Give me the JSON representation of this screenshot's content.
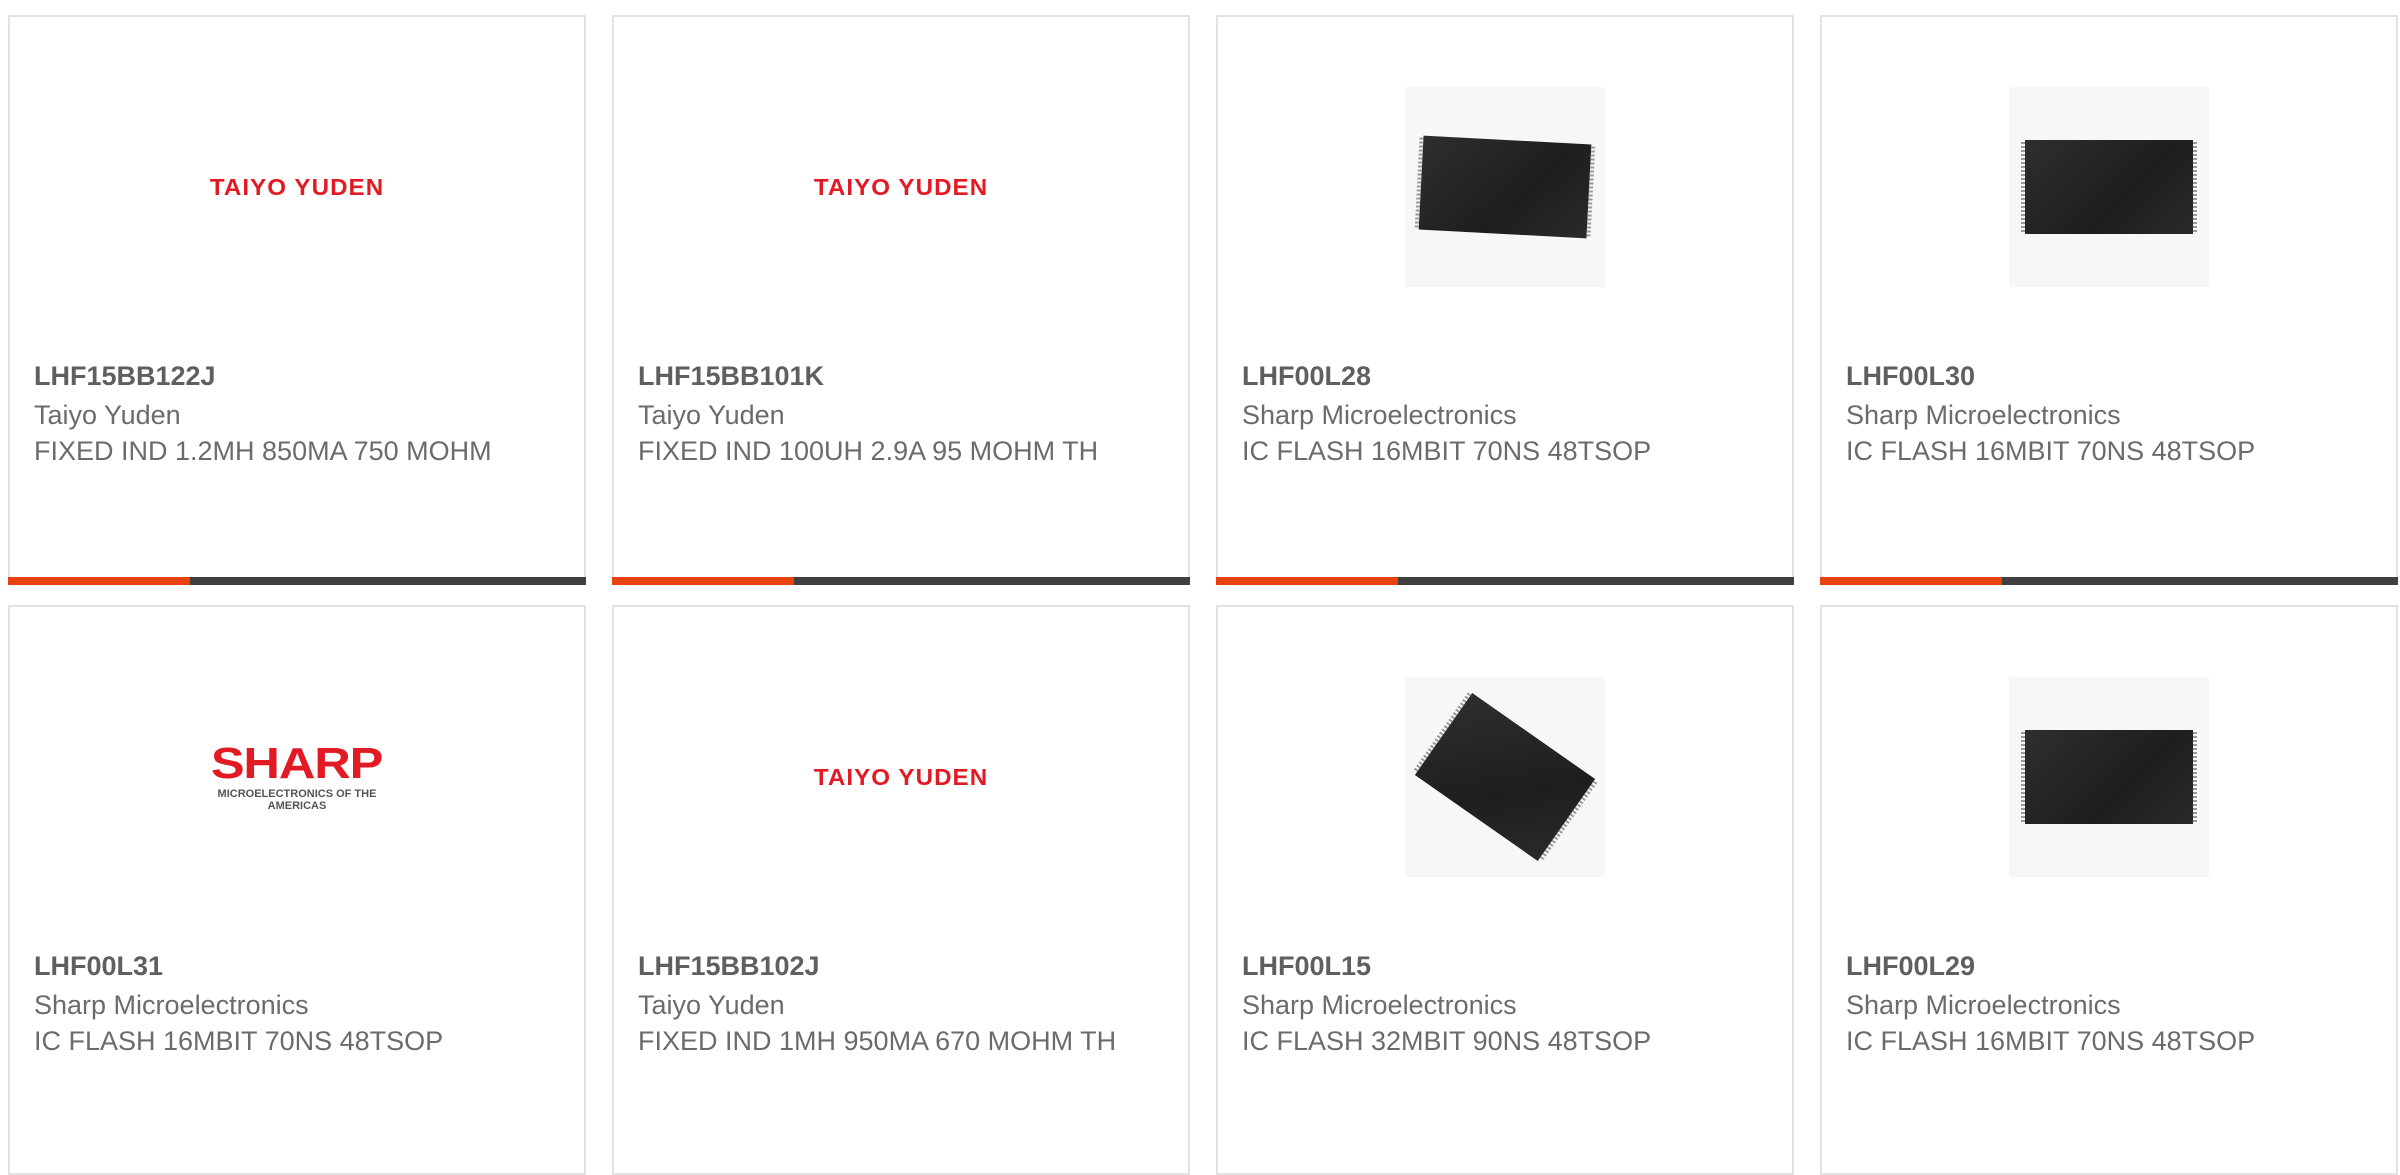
{
  "products": [
    {
      "part_number": "LHF15BB122J",
      "manufacturer": "Taiyo Yuden",
      "description": "FIXED IND 1.2MH 850MA 750 MOHM",
      "image": "taiyo-yuden-logo",
      "logo_text": "TAIYO YUDEN"
    },
    {
      "part_number": "LHF15BB101K",
      "manufacturer": "Taiyo Yuden",
      "description": "FIXED IND 100UH 2.9A 95 MOHM TH",
      "image": "taiyo-yuden-logo",
      "logo_text": "TAIYO YUDEN"
    },
    {
      "part_number": "LHF00L28",
      "manufacturer": "Sharp Microelectronics",
      "description": "IC FLASH 16MBIT 70NS 48TSOP",
      "image": "tsop-chip-photo"
    },
    {
      "part_number": "LHF00L30",
      "manufacturer": "Sharp Microelectronics",
      "description": "IC FLASH 16MBIT 70NS 48TSOP",
      "image": "tsop-chip-photo"
    },
    {
      "part_number": "LHF00L31",
      "manufacturer": "Sharp Microelectronics",
      "description": "IC FLASH 16MBIT 70NS 48TSOP",
      "image": "sharp-logo",
      "logo_text": "SHARP",
      "logo_subtext": "MICROELECTRONICS OF THE AMERICAS"
    },
    {
      "part_number": "LHF15BB102J",
      "manufacturer": "Taiyo Yuden",
      "description": "FIXED IND 1MH 950MA 670 MOHM TH",
      "image": "taiyo-yuden-logo",
      "logo_text": "TAIYO YUDEN"
    },
    {
      "part_number": "LHF00L15",
      "manufacturer": "Sharp Microelectronics",
      "description": "IC FLASH 32MBIT 90NS 48TSOP",
      "image": "tsop-chip-photo"
    },
    {
      "part_number": "LHF00L29",
      "manufacturer": "Sharp Microelectronics",
      "description": "IC FLASH 16MBIT 70NS 48TSOP",
      "image": "tsop-chip-photo"
    }
  ],
  "colors": {
    "accent": "#e8410e",
    "bar": "#3f3f3f",
    "border": "#e2e2e2",
    "logo_red": "#e21a23",
    "text_gray": "#6b6b6b"
  }
}
